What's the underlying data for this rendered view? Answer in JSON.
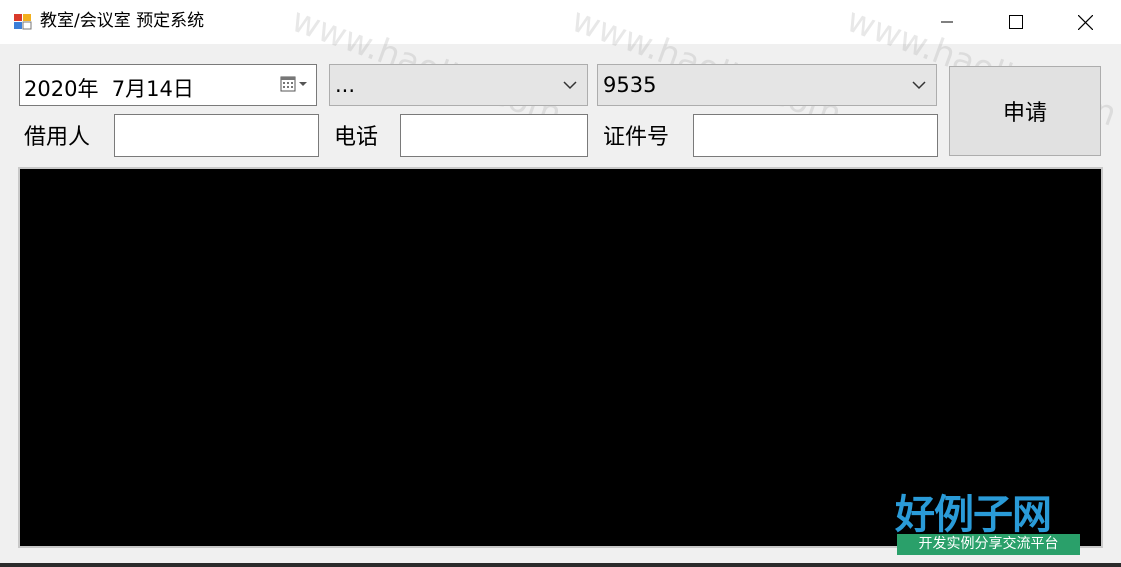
{
  "window": {
    "title": "教室/会议室 预定系统"
  },
  "form": {
    "date_value": "2020年  7月14日",
    "combo_room": "...",
    "combo_number": "9535",
    "borrower_label": "借用人",
    "borrower_value": "",
    "phone_label": "电话",
    "phone_value": "",
    "id_label": "证件号",
    "id_value": "",
    "apply_label": "申请"
  },
  "watermark": {
    "site_text": "www.haolizi.com",
    "logo_text": "好例子网",
    "slogan_text": "开发实例分享交流平台"
  },
  "colors": {
    "panel": "#000000",
    "logo": "#2a9bd8",
    "slogan_bg": "#2aa06a"
  }
}
